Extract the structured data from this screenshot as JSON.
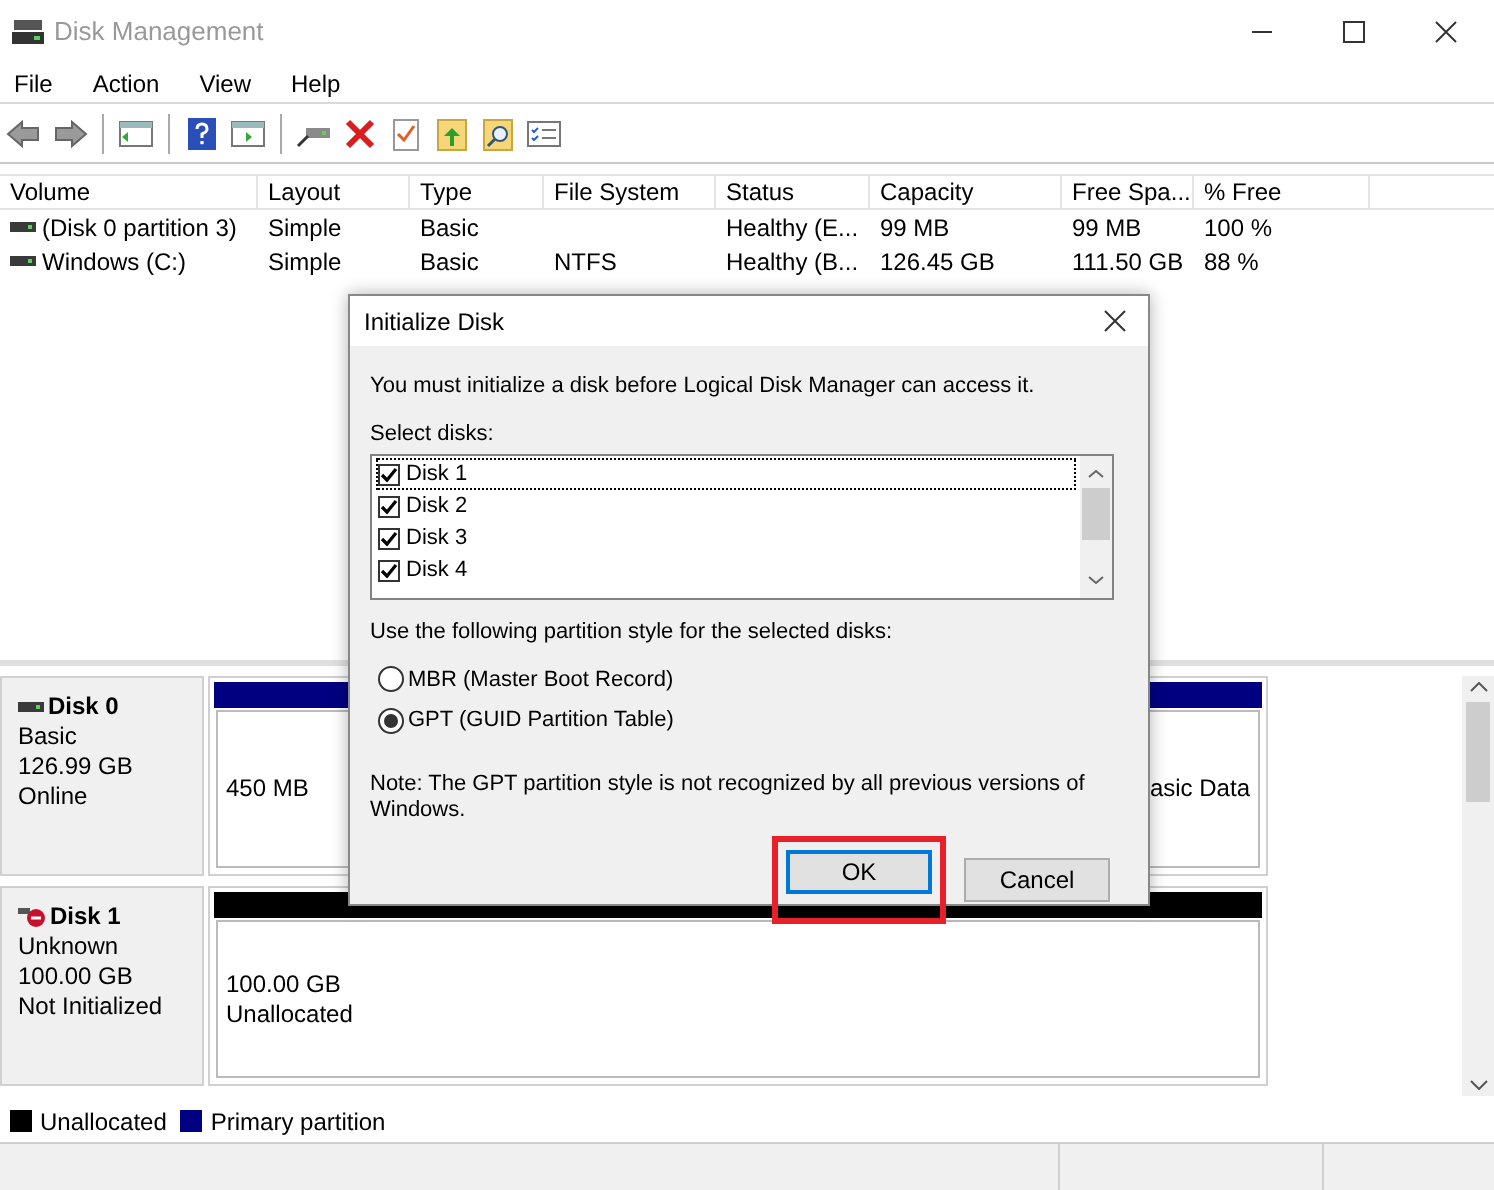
{
  "window": {
    "title": "Disk Management"
  },
  "menu": [
    "File",
    "Action",
    "View",
    "Help"
  ],
  "volume_table": {
    "columns": [
      "Volume",
      "Layout",
      "Type",
      "File System",
      "Status",
      "Capacity",
      "Free Spa...",
      "% Free"
    ],
    "rows": [
      {
        "cells": [
          "(Disk 0 partition 3)",
          "Simple",
          "Basic",
          "",
          "Healthy (E...",
          "99 MB",
          "99 MB",
          "100 %"
        ]
      },
      {
        "cells": [
          "Windows (C:)",
          "Simple",
          "Basic",
          "NTFS",
          "Healthy (B...",
          "126.45 GB",
          "111.50 GB",
          "88 %"
        ]
      }
    ]
  },
  "disks": [
    {
      "name": "Disk 0",
      "kind": "online",
      "type": "Basic",
      "size": "126.99 GB",
      "status": "Online",
      "partitions": [
        {
          "kind": "primary",
          "lines": [
            "450 MB"
          ]
        },
        {
          "kind": "primary",
          "lines": [
            "asic Data"
          ]
        }
      ]
    },
    {
      "name": "Disk 1",
      "kind": "error",
      "type": "Unknown",
      "size": "100.00 GB",
      "status": "Not Initialized",
      "partitions": [
        {
          "kind": "unallocated",
          "lines": [
            "100.00 GB",
            "Unallocated"
          ]
        }
      ]
    }
  ],
  "legend": [
    {
      "label": "Unallocated",
      "color": "#000000"
    },
    {
      "label": "Primary partition",
      "color": "#000080"
    }
  ],
  "dialog": {
    "title": "Initialize Disk",
    "message": "You must initialize a disk before Logical Disk Manager can access it.",
    "select_label": "Select disks:",
    "disks": [
      {
        "label": "Disk 1",
        "checked": true
      },
      {
        "label": "Disk 2",
        "checked": true
      },
      {
        "label": "Disk 3",
        "checked": true
      },
      {
        "label": "Disk 4",
        "checked": true
      }
    ],
    "style_label": "Use the following partition style for the selected disks:",
    "options": [
      {
        "label": "MBR (Master Boot Record)",
        "selected": false
      },
      {
        "label": "GPT (GUID Partition Table)",
        "selected": true
      }
    ],
    "note": "Note: The GPT partition style is not recognized by all previous versions of Windows.",
    "buttons": [
      {
        "label": "OK",
        "kind": "default",
        "highlighted": true
      },
      {
        "label": "Cancel",
        "kind": "normal",
        "highlighted": false
      }
    ]
  }
}
